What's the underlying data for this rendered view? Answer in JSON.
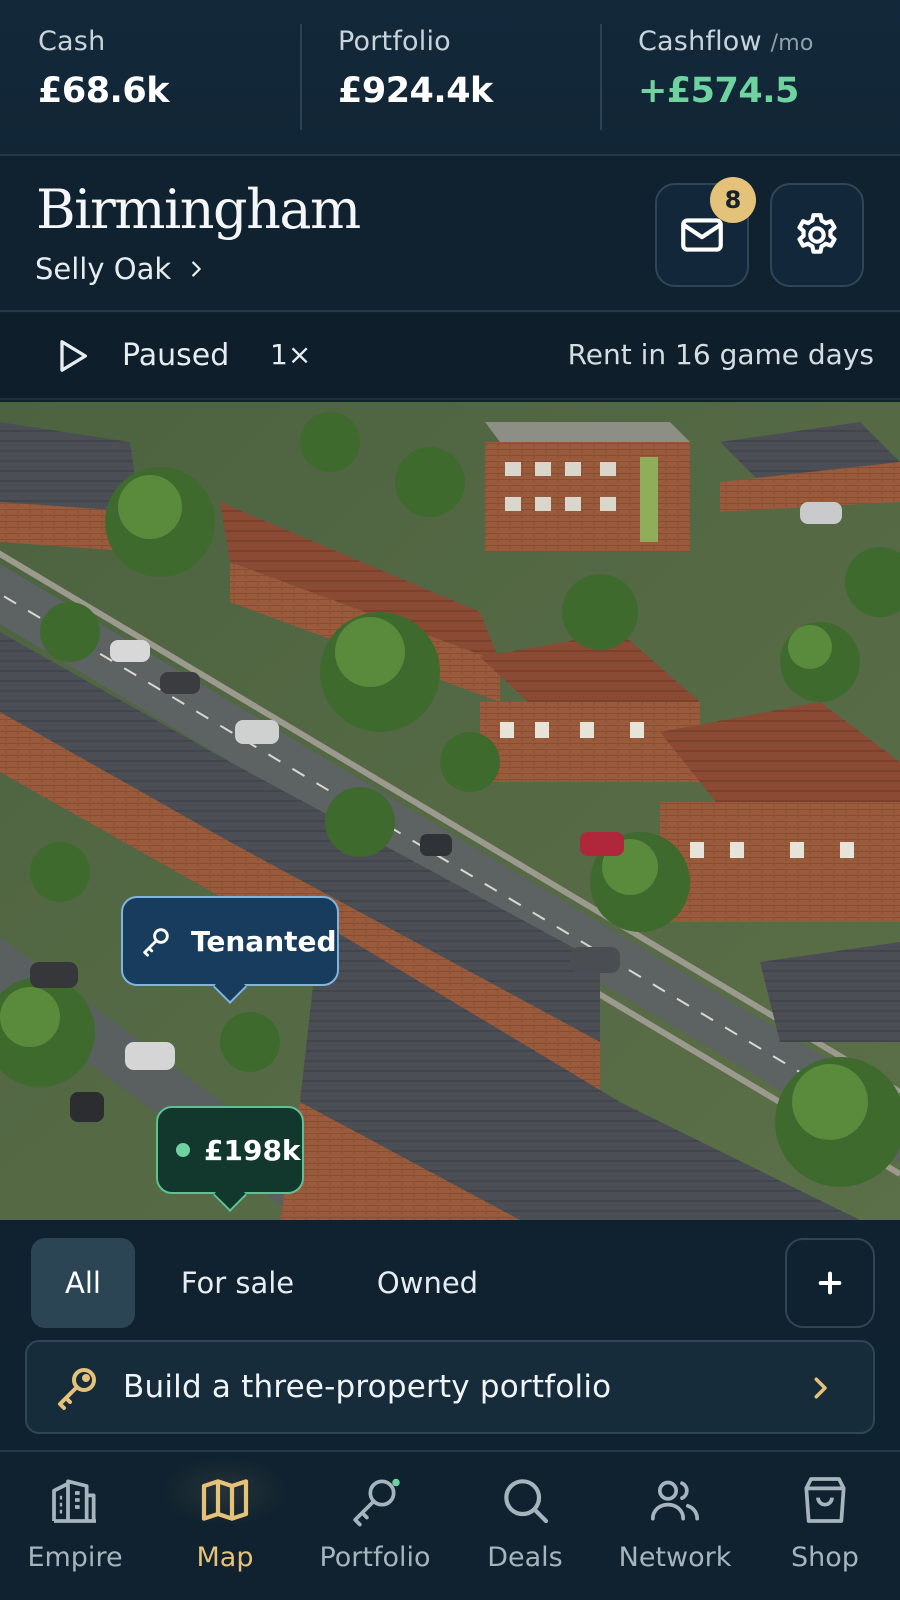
{
  "stats": {
    "cash": {
      "label": "Cash",
      "value": "£68.6k"
    },
    "portfolio": {
      "label": "Portfolio",
      "value": "£924.4k"
    },
    "cashflow": {
      "label": "Cashflow",
      "unit": "/mo",
      "value": "+£574.5"
    }
  },
  "header": {
    "city": "Birmingham",
    "district": "Selly Oak",
    "mail_badge": "8"
  },
  "playback": {
    "status": "Paused",
    "speed": "1×",
    "rent_notice": "Rent in 16 game days"
  },
  "map": {
    "pins": {
      "tenanted_label": "Tenanted",
      "price_label": "£198k"
    }
  },
  "filters": {
    "all": "All",
    "for_sale": "For sale",
    "owned": "Owned",
    "active": "All"
  },
  "goal": {
    "text": "Build a three-property portfolio"
  },
  "nav": {
    "active": "Map",
    "items": [
      {
        "label": "Empire",
        "icon": "building-icon"
      },
      {
        "label": "Map",
        "icon": "map-icon"
      },
      {
        "label": "Portfolio",
        "icon": "key-icon"
      },
      {
        "label": "Deals",
        "icon": "search-icon"
      },
      {
        "label": "Network",
        "icon": "users-icon"
      },
      {
        "label": "Shop",
        "icon": "shopping-bag-icon"
      }
    ]
  },
  "colors": {
    "accent_gold": "#e5c27a",
    "positive_green": "#6fd3a0",
    "background": "#10222f",
    "tenanted_blue": "#183c5e"
  }
}
